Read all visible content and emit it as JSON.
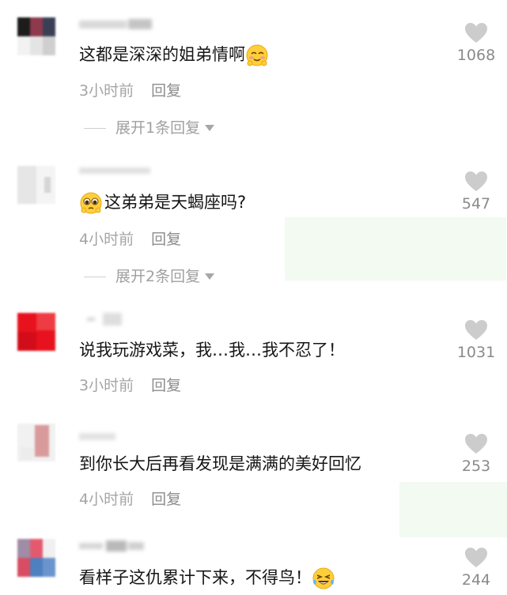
{
  "comments": [
    {
      "text": "这都是深深的姐弟情啊",
      "emoji": "shy-smile-emoji",
      "time": "3小时前",
      "reply": "回复",
      "expand": "展开1条回复",
      "likes": "1068"
    },
    {
      "text": "这弟弟是天蝎座吗?",
      "emoji": "pleading-face-emoji",
      "time": "4小时前",
      "reply": "回复",
      "expand": "展开2条回复",
      "likes": "547"
    },
    {
      "text": "说我玩游戏菜，我…我…我不忍了！",
      "time": "3小时前",
      "reply": "回复",
      "likes": "1031"
    },
    {
      "text": "到你长大后再看发现是满满的美好回忆",
      "time": "4小时前",
      "reply": "回复",
      "likes": "253"
    },
    {
      "text": "看样子这仇累计下来，不得鸟！",
      "emoji": "laughing-tears-emoji",
      "likes": "244"
    }
  ],
  "colors": {
    "like_icon": "#cccccc",
    "meta_text": "#a5a5a5",
    "body_text": "#161616"
  }
}
